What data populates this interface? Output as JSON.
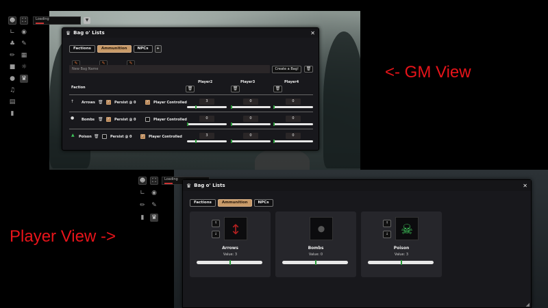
{
  "labels": {
    "gm": "<- GM View",
    "player": "Player View ->"
  },
  "loading": {
    "gm": "Loading",
    "player": "Loading"
  },
  "gm": {
    "window_title": "Bag o' Lists",
    "tabs": [
      {
        "label": "Factions"
      },
      {
        "label": "Ammunition"
      },
      {
        "label": "NPCs"
      }
    ],
    "add_tab": "+",
    "new_bag_placeholder": "New Bag Name",
    "create_button": "Create a Bag!",
    "faction_header": "Faction",
    "players": [
      "Player2",
      "Player3",
      "Player4"
    ],
    "persist_label": "Persist @ 0",
    "player_controlled_label": "Player Controlled",
    "rows": [
      {
        "name": "Arrows",
        "persist": true,
        "player_controlled": true,
        "values": [
          "3",
          "0",
          "0"
        ],
        "fills": [
          0.2,
          0.0,
          0.0
        ]
      },
      {
        "name": "Bombs",
        "persist": true,
        "player_controlled": false,
        "values": [
          "0",
          "0",
          "0"
        ],
        "fills": [
          0.0,
          0.0,
          0.0
        ]
      },
      {
        "name": "Poison",
        "persist": false,
        "player_controlled": true,
        "values": [
          "3",
          "0",
          "0"
        ],
        "fills": [
          0.2,
          0.0,
          0.0
        ]
      }
    ]
  },
  "player": {
    "window_title": "Bag o' Lists",
    "tabs": [
      {
        "label": "Factions"
      },
      {
        "label": "Ammunition"
      },
      {
        "label": "NPCs"
      }
    ],
    "cards": [
      {
        "name": "Arrows",
        "value": "Value: 3",
        "fill": 0.5
      },
      {
        "name": "Bombs",
        "value": "Value: 0",
        "fill": 0.5
      },
      {
        "name": "Poison",
        "value": "Value: 3",
        "fill": 0.5
      }
    ]
  },
  "colors": {
    "accent": "#c89a68",
    "label_red": "#e8141a",
    "slider_knob": "#2a9a3a"
  }
}
